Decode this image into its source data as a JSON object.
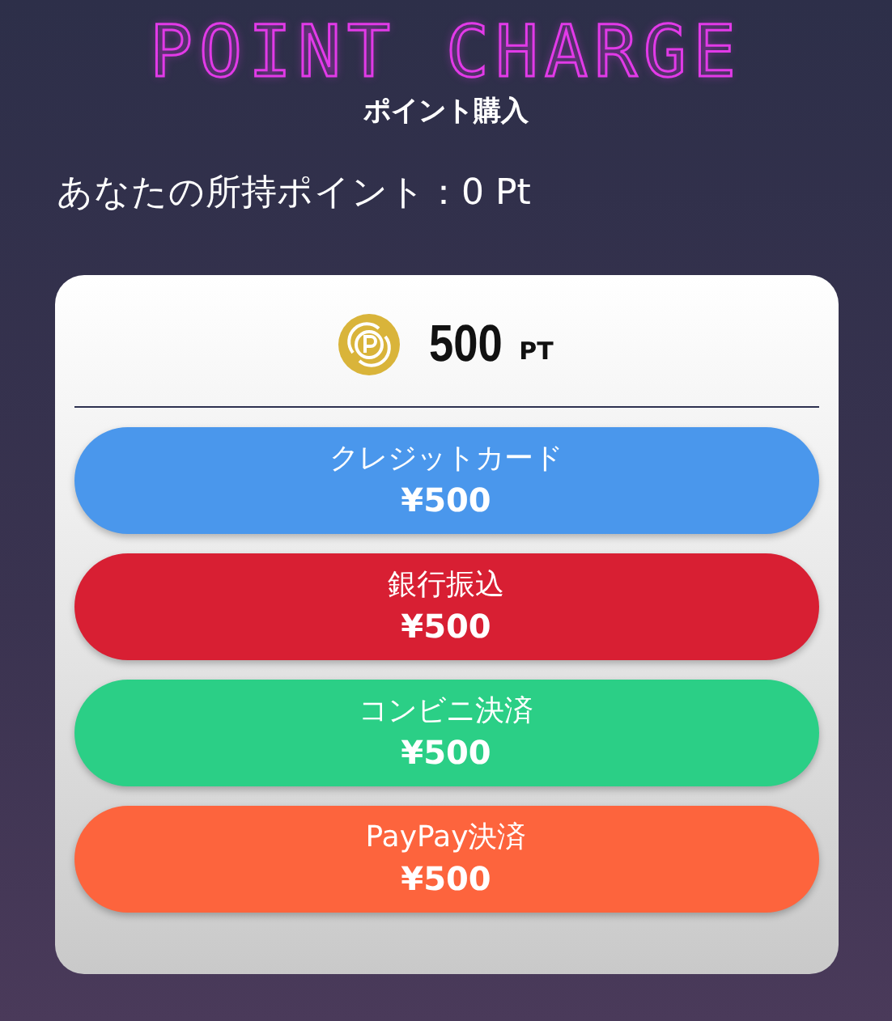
{
  "title": "POINT CHARGE",
  "subtitle": "ポイント購入",
  "balance": "あなたの所持ポイント：0 Pt",
  "package": {
    "amount": "500",
    "unit": "PT"
  },
  "methods": [
    {
      "label": "クレジットカード",
      "price": "¥500",
      "color": "#4a97ec"
    },
    {
      "label": "銀行振込",
      "price": "¥500",
      "color": "#d81f33"
    },
    {
      "label": "コンビニ決済",
      "price": "¥500",
      "color": "#2bcf86"
    },
    {
      "label": "PayPay決済",
      "price": "¥500",
      "color": "#fd643d"
    }
  ]
}
